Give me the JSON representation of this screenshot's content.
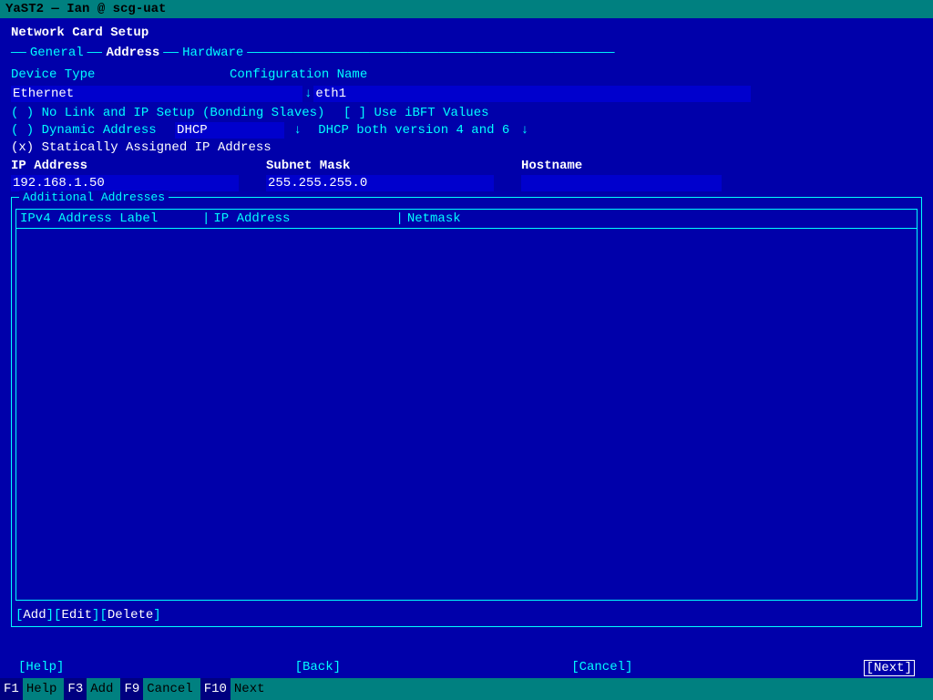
{
  "titlebar": {
    "text": "YaST2 — Ian @ scg-uat"
  },
  "header": {
    "title": "Network Card Setup"
  },
  "tabs": {
    "border_left": "—",
    "border_right": "—",
    "items": [
      {
        "label": "General",
        "active": false
      },
      {
        "label": "Address",
        "active": true
      },
      {
        "label": "Hardware",
        "active": false
      }
    ]
  },
  "form": {
    "device_type_label": "Device Type",
    "device_type_value": "Ethernet",
    "config_name_label": "Configuration Name",
    "config_name_value": "eth1",
    "radio_options": [
      {
        "id": "no-link",
        "selected": false,
        "label": "No Link and IP Setup (Bonding Slaves)",
        "extra": "[ ] Use iBFT Values"
      },
      {
        "id": "dynamic",
        "selected": false,
        "label": "Dynamic Address",
        "dhcp_value": "DHCP",
        "dhcp_extra": "DHCP both version 4 and 6"
      },
      {
        "id": "static",
        "selected": true,
        "label": "Statically Assigned IP Address"
      }
    ],
    "ip_address_header": "IP Address",
    "subnet_mask_header": "Subnet Mask",
    "hostname_header": "Hostname",
    "ip_address_value": "192.168.1.50",
    "subnet_mask_value": "255.255.255.0",
    "hostname_value": ""
  },
  "additional_addresses": {
    "label": "Additional Addresses",
    "table_headers": [
      "IPv4 Address Label",
      "IP Address",
      "Netmask"
    ],
    "rows": []
  },
  "action_buttons": [
    {
      "label": "Add"
    },
    {
      "label": "Edit"
    },
    {
      "label": "Delete"
    }
  ],
  "bottom_nav": {
    "help": "[Help]",
    "back": "[Back]",
    "cancel": "[Cancel]",
    "next": "[Next]"
  },
  "fkeys": [
    {
      "num": "F1",
      "label": "Help"
    },
    {
      "num": "F3",
      "label": "Add"
    },
    {
      "num": "F9",
      "label": "Cancel"
    },
    {
      "num": "F10",
      "label": "Next"
    }
  ]
}
